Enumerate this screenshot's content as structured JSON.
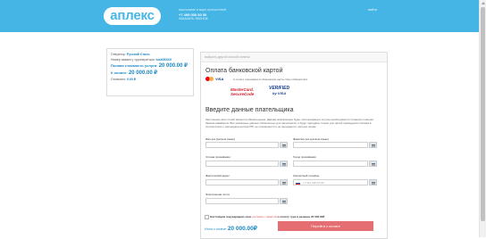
{
  "header": {
    "logo": "аплекс",
    "tagline": "ваш компас в мире путешествий",
    "phone": "+7 495 000 00 00",
    "callback": "ЗАКАЗАТЬ ЗВОНОК",
    "exit": "выйти"
  },
  "order": {
    "operator_label": "Оператор:",
    "operator_value": "Русский Стиль",
    "request_label": "Номер заявки у туроператора:",
    "request_value": "tus6054XX",
    "full_cost_label": "Полная стоимость услуги:",
    "full_cost_value": "20 000.00 ₽",
    "to_pay_label": "К оплате:",
    "to_pay_value": "20 000.00 ₽",
    "paid_label": "Оплачено:",
    "paid_value": "0.00 ₽"
  },
  "payment": {
    "select_method": "выбрать другой способ оплаты",
    "title": "Оплата банковской картой",
    "visa": "VISA",
    "accept_text": "К оплате принимаются банковские карты Visa и MasterCard",
    "mastercard_secure_line1": "MasterCard.",
    "mastercard_secure_line2": "SecureCode",
    "verified_line1": "VERIFIED",
    "verified_line2": "by VISA",
    "payer_title": "Введите данные плательщика",
    "note": "Заполнение всех полей является обязательным. Данная информация будет использована в случае необходимости проверки платежа банком-эквайером. Все указанные данные обязательны для заполнения, и будут переданы только для целей проведения платежа в соответствии с законодательством РФ, не сохраняются и не передаются третьим лицам.",
    "fields": {
      "first_name": "Имя (на русском языке)",
      "last_name": "Фамилия (на русском языке)",
      "country": "Страна проживания",
      "city": "Город проживания",
      "address": "Фактический адрес",
      "phone": "Контактный телефон",
      "phone_placeholder": "+7 912 345-67-89",
      "email": "Электронная почта"
    },
    "agree_prefix": "Настоящим подтверждаю свое",
    "agree_link": "согласие с офертой",
    "agree_suffix": "и оплату тура в размере 20 000.00₽",
    "total_label": "Итого к оплате:",
    "total_value": "20 000.00₽",
    "pay_button": "Перейти к оплате"
  },
  "colors": {
    "brand": "#45b5e6",
    "accent_text": "#1a87c2",
    "pay_button": "#e46e72"
  }
}
